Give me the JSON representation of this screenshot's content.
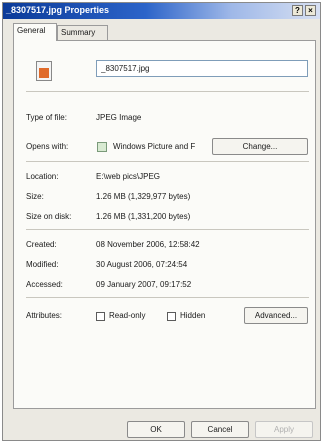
{
  "window": {
    "title": "_8307517.jpg Properties",
    "help_label": "?",
    "close_label": "×"
  },
  "tabs": [
    {
      "label": "General"
    },
    {
      "label": "Summary"
    }
  ],
  "general": {
    "filename": "_8307517.jpg",
    "type_label": "Type of file:",
    "type_value": "JPEG Image",
    "opens_label": "Opens with:",
    "opens_value": "Windows Picture and F",
    "change_label": "Change...",
    "location_label": "Location:",
    "location_value": "E:\\web pics\\JPEG",
    "size_label": "Size:",
    "size_value": "1.26 MB (1,329,977 bytes)",
    "disk_label": "Size on disk:",
    "disk_value": "1.26 MB (1,331,200 bytes)",
    "created_label": "Created:",
    "created_value": "08 November 2006, 12:58:42",
    "modified_label": "Modified:",
    "modified_value": "30 August 2006, 07:24:54",
    "accessed_label": "Accessed:",
    "accessed_value": "09 January 2007, 09:17:52",
    "attributes_label": "Attributes:",
    "readonly_label": "Read-only",
    "hidden_label": "Hidden",
    "advanced_label": "Advanced..."
  },
  "footer": {
    "ok_label": "OK",
    "cancel_label": "Cancel",
    "apply_label": "Apply"
  }
}
